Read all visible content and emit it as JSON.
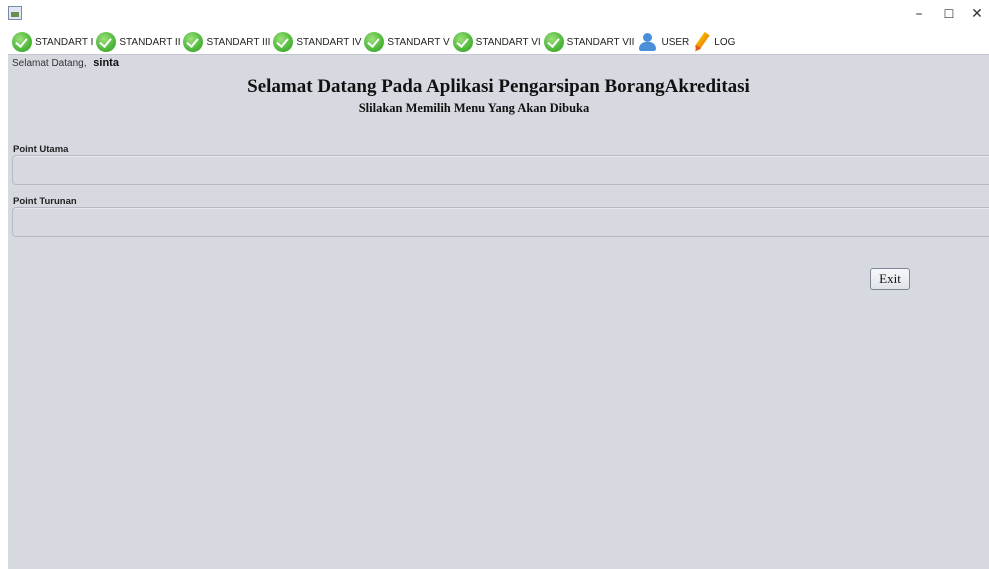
{
  "window": {
    "minimize_glyph": "–",
    "maximize_glyph": "☐",
    "close_glyph": "✕"
  },
  "menu": {
    "items": [
      {
        "label": "STANDART I",
        "icon": "check-icon"
      },
      {
        "label": "STANDART II",
        "icon": "check-icon"
      },
      {
        "label": "STANDART III",
        "icon": "check-icon"
      },
      {
        "label": "STANDART IV",
        "icon": "check-icon"
      },
      {
        "label": "STANDART V",
        "icon": "check-icon"
      },
      {
        "label": "STANDART VI",
        "icon": "check-icon"
      },
      {
        "label": "STANDART VII",
        "icon": "check-icon"
      },
      {
        "label": "USER",
        "icon": "user-icon"
      },
      {
        "label": "LOG",
        "icon": "pencil-icon"
      }
    ]
  },
  "header": {
    "greeting": "Selamat Datang,",
    "username": "sinta",
    "title": "Selamat Datang Pada Aplikasi Pengarsipan BorangAkreditasi",
    "subtitle": "Slilakan Memilih Menu Yang Akan Dibuka"
  },
  "form": {
    "point_utama_label": "Point Utama",
    "point_utama_value": "",
    "point_turunan_label": "Point Turunan",
    "point_turunan_value": ""
  },
  "buttons": {
    "exit_label": "Exit"
  },
  "colors": {
    "panel_bg": "#d6d9e0",
    "check_green": "#4db83a",
    "user_blue": "#4a90d9",
    "pencil_orange": "#f5b400"
  }
}
